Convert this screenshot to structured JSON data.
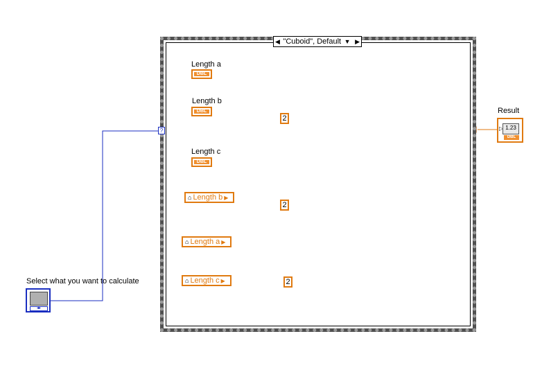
{
  "case_selector": {
    "value": "\"Cuboid\", Default",
    "prev_arrow": "◀",
    "next_arrow": "▶",
    "dropdown": "▼"
  },
  "selector_terminal": "?",
  "controls": {
    "length_a": {
      "label": "Length a",
      "type_tag": "DBL"
    },
    "length_b": {
      "label": "Length b",
      "type_tag": "DBL"
    },
    "length_c": {
      "label": "Length c",
      "type_tag": "DBL"
    }
  },
  "local_variables": {
    "lv1": "Length b",
    "lv2": "Length a",
    "lv3": "Length c"
  },
  "constants": {
    "c1": "2",
    "c2": "2",
    "c3": "2"
  },
  "operators": {
    "multiply": "×",
    "add": "+"
  },
  "ring_control": {
    "label": "Select what you want to calculate"
  },
  "indicator": {
    "label": "Result",
    "display": "1.23",
    "type_tag": "DBL"
  },
  "colors": {
    "wire_orange": "#e07a10",
    "wire_blue": "#1a2ec0",
    "frame": "#505050"
  }
}
